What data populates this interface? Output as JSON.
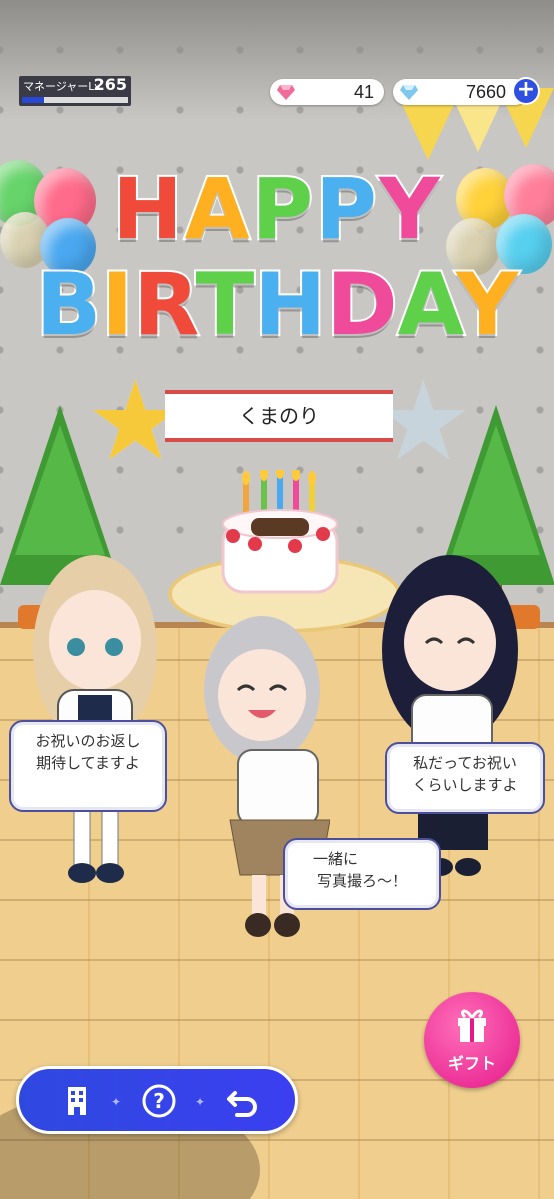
{
  "hud": {
    "level_label": "マネージャーLv",
    "level": "265",
    "level_progress": 0.21,
    "gems_paid": "41",
    "gems_free": "7660"
  },
  "banner": {
    "line1": "HAPPY",
    "line2": "BIRTHDAY",
    "name": "くまのり",
    "letter_colors_line1": [
      "#f04a3a",
      "#ffb020",
      "#5fd04a",
      "#4ab0f0",
      "#f04a9a"
    ],
    "letter_colors_line2": [
      "#4ab0f0",
      "#ffb020",
      "#f04a3a",
      "#5fd04a",
      "#4ab0f0",
      "#f04a9a",
      "#5fd04a",
      "#ffb020"
    ]
  },
  "speech": {
    "left": [
      "お祝いのお返し",
      "期待してますよ"
    ],
    "right": [
      "私だってお祝い",
      "くらいしますよ"
    ],
    "center": [
      "一緒に",
      "写真撮ろ～！"
    ]
  },
  "buttons": {
    "gift_label": "ギフト"
  },
  "icons": {
    "gem_paid": "pink-diamond-icon",
    "gem_free": "blue-diamond-icon",
    "add": "plus-icon",
    "gift": "gift-box-icon",
    "nav": [
      "building-icon",
      "question-icon",
      "back-arrow-icon"
    ]
  },
  "colors": {
    "accent_blue": "#2f49e0",
    "gift_pink": "#e5188c",
    "level_fill": "#2747d6"
  }
}
